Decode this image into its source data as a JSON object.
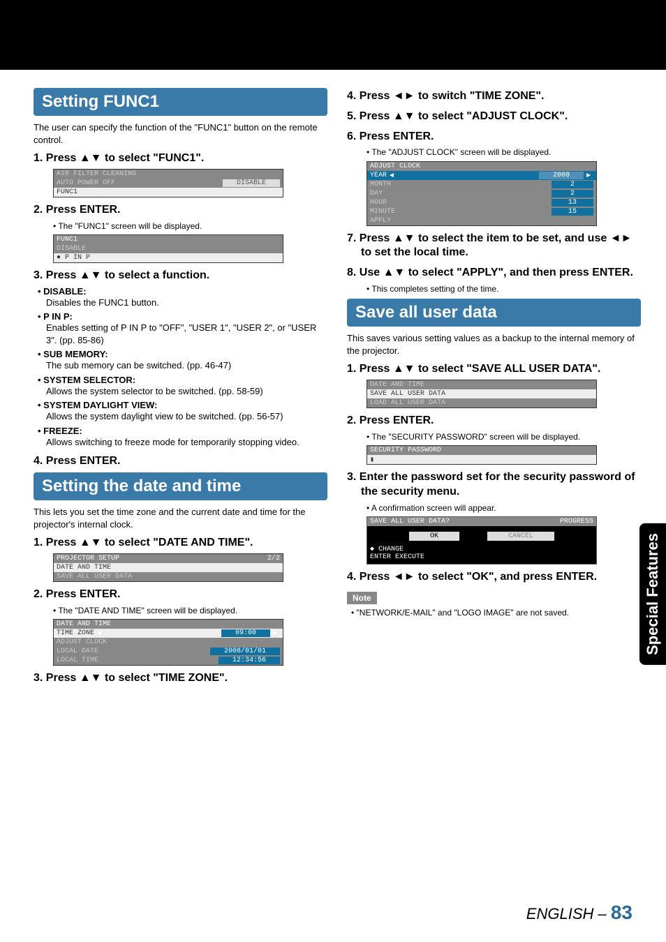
{
  "topbar": {},
  "left": {
    "func1": {
      "title": "Setting FUNC1",
      "lead": "The user can specify the function of the \"FUNC1\" button on the remote control.",
      "step1": "1.  Press ▲▼ to select \"FUNC1\".",
      "menu1": {
        "r1": "AIR FILTER CLEANING",
        "r2": "AUTO POWER OFF",
        "r2v": "DISABLE",
        "r3": "FUNC1"
      },
      "step2": "2.  Press ENTER.",
      "step2sub": "• The \"FUNC1\" screen will be displayed.",
      "menu2": {
        "h": "FUNC1",
        "r1": "DISABLE",
        "r2": "● P IN P"
      },
      "step3": "3.  Press ▲▼ to select a function.",
      "b_disable_h": "• DISABLE:",
      "b_disable": "Disables the FUNC1 button.",
      "b_pinp_h": "• P IN P:",
      "b_pinp": "Enables setting of P IN P to \"OFF\", \"USER 1\", \"USER 2\", or \"USER 3\". (pp. 85-86)",
      "b_sub_h": "• SUB MEMORY:",
      "b_sub": "The sub memory can be switched. (pp. 46-47)",
      "b_sys_h": "• SYSTEM SELECTOR:",
      "b_sys": "Allows the system selector to be switched. (pp. 58-59)",
      "b_day_h": "• SYSTEM DAYLIGHT VIEW:",
      "b_day": "Allows the system daylight view to be switched. (pp. 56-57)",
      "b_frz_h": "• FREEZE:",
      "b_frz": "Allows switching to freeze mode for temporarily stopping video.",
      "step4": "4.  Press ENTER."
    },
    "date": {
      "title": "Setting the date and time",
      "lead": "This lets you set the time zone and the current date and time for the projector's internal clock.",
      "step1": "1.  Press ▲▼ to select \"DATE AND TIME\".",
      "menu1": {
        "h": "PROJECTOR SETUP",
        "hv": "2/2",
        "r1": "DATE AND TIME",
        "r2": "SAVE ALL USER DATA"
      },
      "step2": "2.  Press ENTER.",
      "step2sub": "• The \"DATE AND TIME\" screen will be displayed.",
      "menu2": {
        "h": "DATE AND TIME",
        "r1": "TIME ZONE",
        "r1v": "09:00",
        "r2": "ADJUST CLOCK",
        "r3": "LOCAL DATE",
        "r3v": "2008/01/01",
        "r4": "LOCAL TIME",
        "r4v": "12:34:56"
      },
      "step3": "3.  Press ▲▼ to select \"TIME ZONE\"."
    }
  },
  "right": {
    "cont": {
      "step4": "4.  Press ◄► to switch \"TIME ZONE\".",
      "step5": "5.  Press ▲▼ to select \"ADJUST CLOCK\".",
      "step6": "6.  Press ENTER.",
      "step6sub": "• The \"ADJUST CLOCK\" screen will be displayed.",
      "menu": {
        "h": "ADJUST CLOCK",
        "r1": "YEAR",
        "r1v": "2008",
        "r2": "MONTH",
        "r2v": "2",
        "r3": "DAY",
        "r3v": "2",
        "r4": "HOUR",
        "r4v": "13",
        "r5": "MINUTE",
        "r5v": "15",
        "r6": "APPLY"
      },
      "step7": "7.  Press ▲▼ to select the item to be set, and use ◄► to set the local time.",
      "step8": "8.  Use ▲▼ to select \"APPLY\", and then press ENTER.",
      "step8sub": "• This completes setting of the time."
    },
    "save": {
      "title": "Save all user data",
      "lead": "This saves various setting values as a backup to the internal memory of the projector.",
      "step1": "1.  Press ▲▼ to select \"SAVE ALL USER DATA\".",
      "menu1": {
        "r1": "DATE AND TIME",
        "r2": "SAVE ALL USER DATA",
        "r3": "LOAD ALL USER DATA"
      },
      "step2": "2.  Press ENTER.",
      "step2sub": "• The \"SECURITY PASSWORD\" screen will be displayed.",
      "menu2": {
        "h": "SECURITY PASSWORD",
        "cursor": "▮"
      },
      "step3": "3.  Enter the password set for the security password of the security menu.",
      "step3sub": "• A confirmation screen will appear.",
      "dialog": {
        "h": "SAVE ALL USER DATA?",
        "hv": "PROGRESS",
        "ok": "OK",
        "cancel": "CANCEL",
        "l1": "◆   CHANGE",
        "l2": "ENTER EXECUTE"
      },
      "step4": "4.  Press ◄► to select \"OK\", and press ENTER.",
      "note_label": "Note",
      "note": "• \"NETWORK/E-MAIL\" and \"LOGO IMAGE\" are not saved."
    }
  },
  "sidetab": "Special Features",
  "footer": {
    "lang": "ENGLISH – ",
    "page": "83"
  }
}
